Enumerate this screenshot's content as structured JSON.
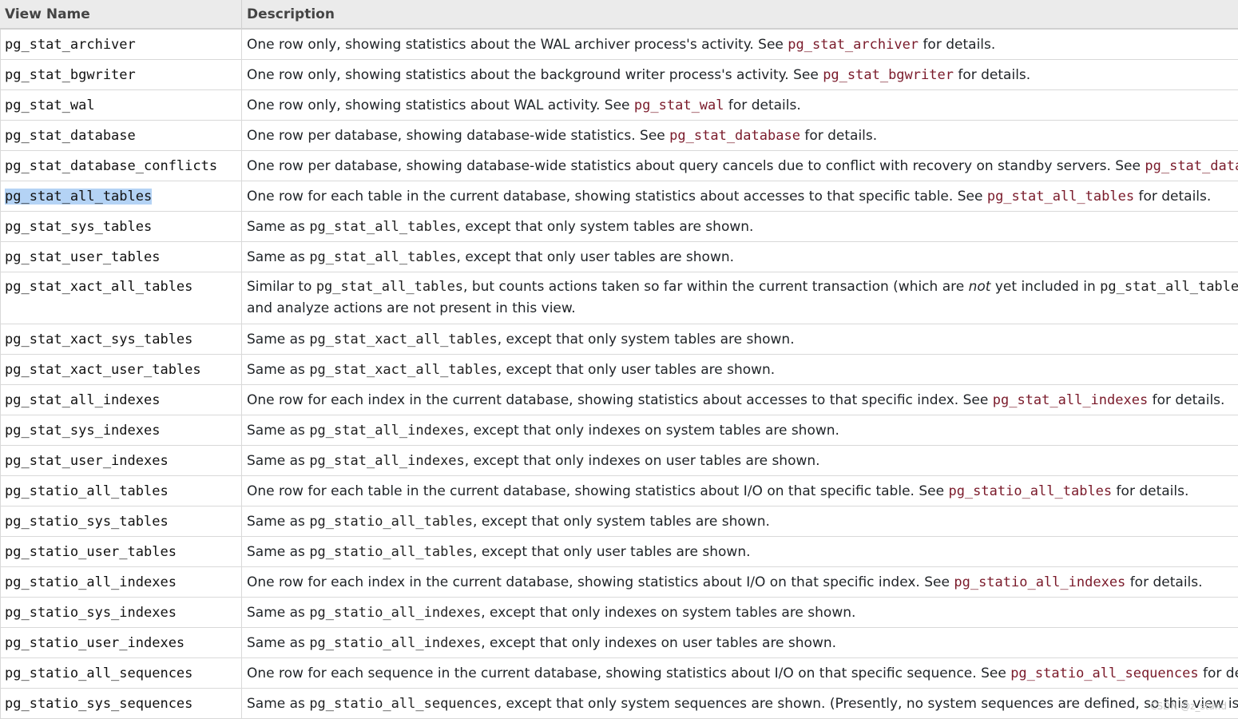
{
  "headers": {
    "view_name": "View Name",
    "description": "Description"
  },
  "rows": [
    {
      "name": "pg_stat_archiver",
      "pre": "One row only, showing statistics about the WAL archiver process's activity. See ",
      "code": "pg_stat_archiver",
      "post": " for details."
    },
    {
      "name": "pg_stat_bgwriter",
      "pre": "One row only, showing statistics about the background writer process's activity. See ",
      "code": "pg_stat_bgwriter",
      "post": " for details."
    },
    {
      "name": "pg_stat_wal",
      "pre": "One row only, showing statistics about WAL activity. See ",
      "code": "pg_stat_wal",
      "post": " for details."
    },
    {
      "name": "pg_stat_database",
      "pre": "One row per database, showing database-wide statistics. See ",
      "code": "pg_stat_database",
      "post": " for details."
    },
    {
      "name": "pg_stat_database_conflicts",
      "pre": "One row per database, showing database-wide statistics about query cancels due to conflict with recovery on standby servers. See ",
      "code": "pg_stat_databa",
      "post": ""
    },
    {
      "name": "pg_stat_all_tables",
      "pre": "One row for each table in the current database, showing statistics about accesses to that specific table. See ",
      "code": "pg_stat_all_tables",
      "post": " for details."
    },
    {
      "name": "pg_stat_sys_tables",
      "pre": "Same as ",
      "mono": "pg_stat_all_tables",
      "post": ", except that only system tables are shown."
    },
    {
      "name": "pg_stat_user_tables",
      "pre": "Same as ",
      "mono": "pg_stat_all_tables",
      "post": ", except that only user tables are shown."
    },
    {
      "name": "pg_stat_xact_all_tables",
      "line1_pre": "Similar to ",
      "line1_mono": "pg_stat_all_tables",
      "line1_mid": ", but counts actions taken so far within the current transaction (which are ",
      "line1_em": "not",
      "line1_post": " yet included in ",
      "line1_mono2": "pg_stat_all_table",
      "line2": "and analyze actions are not present in this view."
    },
    {
      "name": "pg_stat_xact_sys_tables",
      "pre": "Same as ",
      "mono": "pg_stat_xact_all_tables",
      "post": ", except that only system tables are shown."
    },
    {
      "name": "pg_stat_xact_user_tables",
      "pre": "Same as ",
      "mono": "pg_stat_xact_all_tables",
      "post": ", except that only user tables are shown."
    },
    {
      "name": "pg_stat_all_indexes",
      "pre": "One row for each index in the current database, showing statistics about accesses to that specific index. See ",
      "code": "pg_stat_all_indexes",
      "post": " for details."
    },
    {
      "name": "pg_stat_sys_indexes",
      "pre": "Same as ",
      "mono": "pg_stat_all_indexes",
      "post": ", except that only indexes on system tables are shown."
    },
    {
      "name": "pg_stat_user_indexes",
      "pre": "Same as ",
      "mono": "pg_stat_all_indexes",
      "post": ", except that only indexes on user tables are shown."
    },
    {
      "name": "pg_statio_all_tables",
      "pre": "One row for each table in the current database, showing statistics about I/O on that specific table. See ",
      "code": "pg_statio_all_tables",
      "post": " for details."
    },
    {
      "name": "pg_statio_sys_tables",
      "pre": "Same as ",
      "mono": "pg_statio_all_tables",
      "post": ", except that only system tables are shown."
    },
    {
      "name": "pg_statio_user_tables",
      "pre": "Same as ",
      "mono": "pg_statio_all_tables",
      "post": ", except that only user tables are shown."
    },
    {
      "name": "pg_statio_all_indexes",
      "pre": "One row for each index in the current database, showing statistics about I/O on that specific index. See ",
      "code": "pg_statio_all_indexes",
      "post": " for details."
    },
    {
      "name": "pg_statio_sys_indexes",
      "pre": "Same as ",
      "mono": "pg_statio_all_indexes",
      "post": ", except that only indexes on system tables are shown."
    },
    {
      "name": "pg_statio_user_indexes",
      "pre": "Same as ",
      "mono": "pg_statio_all_indexes",
      "post": ", except that only indexes on user tables are shown."
    },
    {
      "name": "pg_statio_all_sequences",
      "pre": "One row for each sequence in the current database, showing statistics about I/O on that specific sequence. See ",
      "code": "pg_statio_all_sequences",
      "post": " for det"
    },
    {
      "name": "pg_statio_sys_sequences",
      "pre": "Same as ",
      "mono": "pg_statio_all_sequences",
      "post": ", except that only system sequences are shown. (Presently, no system sequences are defined, so this view is al"
    }
  ],
  "watermark": "CSDN @z_stand"
}
